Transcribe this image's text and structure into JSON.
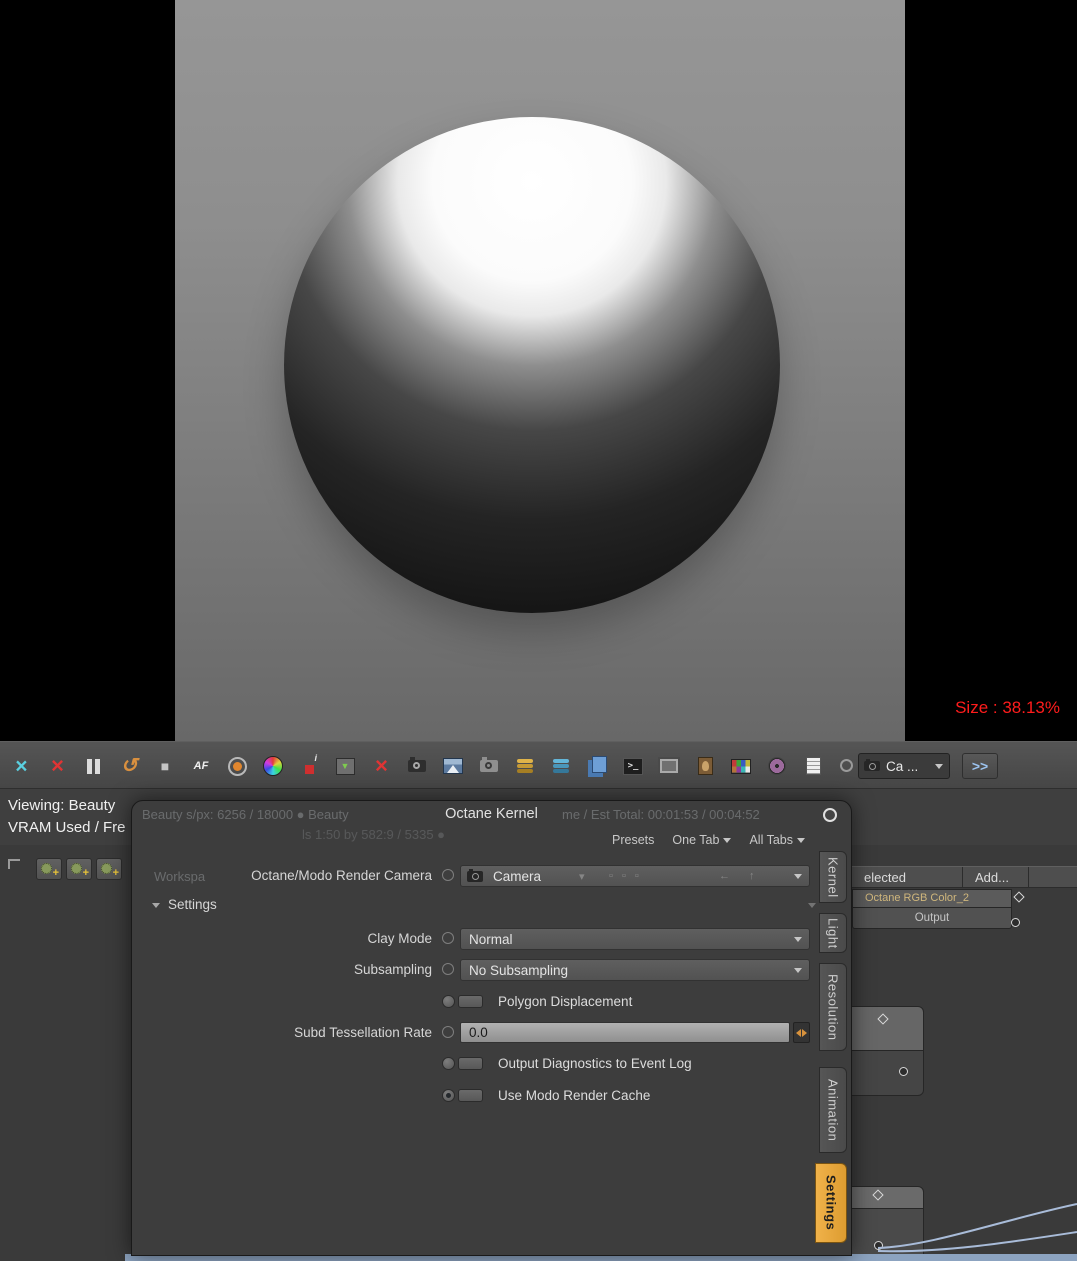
{
  "viewport": {
    "size_label": "Size : 38.13%"
  },
  "toolbar": {
    "icons": [
      {
        "name": "fit-view-icon",
        "glyph": "×"
      },
      {
        "name": "clear-render-icon",
        "glyph": "×"
      },
      {
        "name": "pause-render-icon",
        "glyph": ""
      },
      {
        "name": "restart-render-icon",
        "glyph": "↺"
      },
      {
        "name": "stop-render-icon",
        "glyph": "■"
      },
      {
        "name": "autofocus-icon",
        "glyph": "AF"
      },
      {
        "name": "focus-picker-icon",
        "glyph": ""
      },
      {
        "name": "color-wheel-icon",
        "glyph": ""
      },
      {
        "name": "pixel-info-icon",
        "glyph": "i"
      },
      {
        "name": "render-region-icon",
        "glyph": "▼"
      },
      {
        "name": "clear-film-icon",
        "glyph": "×"
      },
      {
        "name": "camera-picker-icon",
        "glyph": ""
      },
      {
        "name": "image-viewer-icon",
        "glyph": ""
      },
      {
        "name": "snapshot-icon",
        "glyph": ""
      },
      {
        "name": "layers-gold-icon",
        "glyph": ""
      },
      {
        "name": "layers-blue-icon",
        "glyph": ""
      },
      {
        "name": "copy-passes-icon",
        "glyph": ""
      },
      {
        "name": "console-icon",
        "glyph": ">_"
      },
      {
        "name": "framebuffer-icon",
        "glyph": ""
      },
      {
        "name": "portrait-image-icon",
        "glyph": ""
      },
      {
        "name": "color-checker-icon",
        "glyph": ""
      },
      {
        "name": "film-reel-icon",
        "glyph": ""
      },
      {
        "name": "event-log-icon",
        "glyph": ""
      }
    ],
    "camera_select_label": "Ca ...",
    "overflow_label": ">>"
  },
  "status": {
    "line1": "Viewing: Beauty",
    "line2": "VRAM Used / Fre"
  },
  "ghost": {
    "line1_left": "Beauty s/px: 6256 / 18000 ● Beauty",
    "line1_right": "me / Est Total: 00:01:53 / 00:04:52",
    "line2": "ls 1:50 by 582:9 / 5335 ●",
    "workspace": "Workspa"
  },
  "dialog": {
    "title": "Octane Kernel",
    "presets": "Presets",
    "one_tab": "One Tab",
    "all_tabs": "All Tabs",
    "tabs": [
      "Kernel",
      "Light",
      "Resolution",
      "Animation",
      "Settings"
    ],
    "active_tab": "Settings",
    "camera_label": "Octane/Modo Render Camera",
    "camera_value": "Camera",
    "dim_controls": {
      "caret": "▾",
      "squares": "▫ ▫ ▫",
      "left_arrow": "←",
      "up_arrow": "↑"
    },
    "section_label": "Settings",
    "clay_mode_label": "Clay Mode",
    "clay_mode_value": "Normal",
    "subsampling_label": "Subsampling",
    "subsampling_value": "No Subsampling",
    "polygon_displacement_label": "Polygon Displacement",
    "subd_rate_label": "Subd Tessellation Rate",
    "subd_rate_value": "0.0",
    "diagnostics_label": "Output Diagnostics to Event Log",
    "render_cache_label": "Use Modo Render Cache",
    "render_cache_checked": true
  },
  "schematic": {
    "selected_header": "elected",
    "add_label": "Add...",
    "node_title": "Octane RGB Color_2",
    "node_port": "Output",
    "mini_plus": "+"
  },
  "colors": {
    "accent_orange": "#e7a43b",
    "alert_red": "#ff1c1c",
    "wire_blue": "#a9bcd9"
  }
}
